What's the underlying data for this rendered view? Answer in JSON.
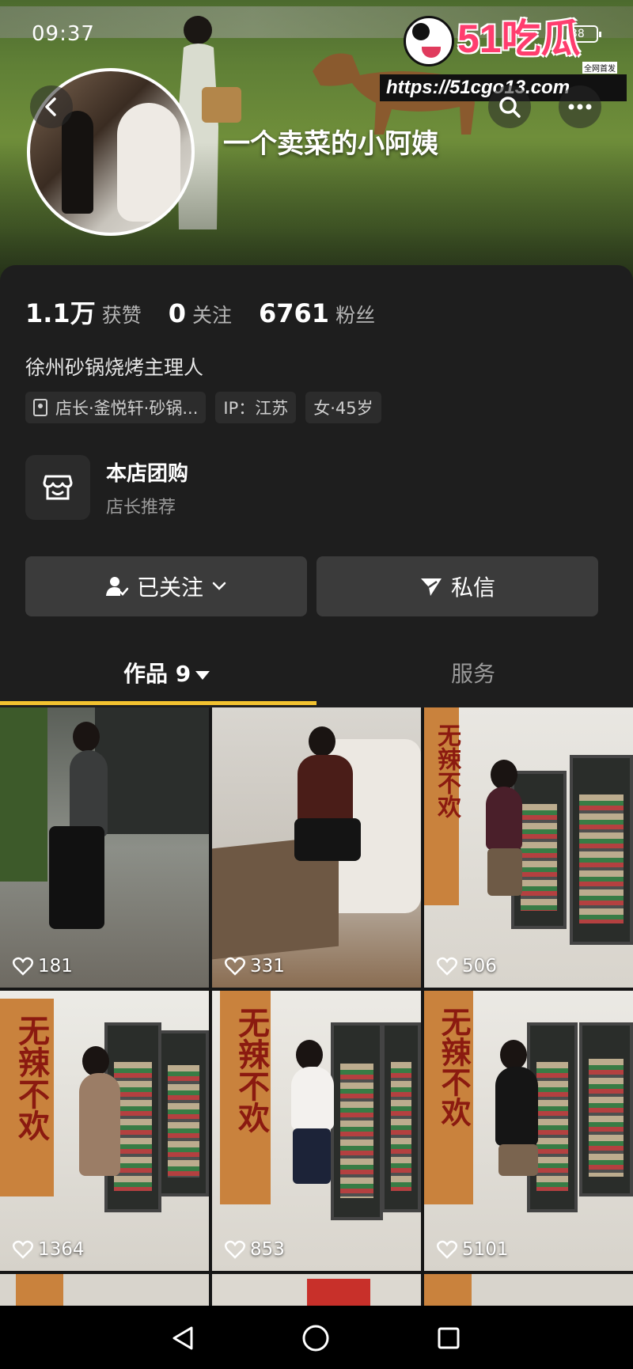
{
  "status_bar": {
    "time": "09:37",
    "battery": "38"
  },
  "watermark": {
    "brand": "51吃瓜",
    "tag": "全网首发",
    "url": "https://51cgo13.com"
  },
  "profile": {
    "nickname": "一个卖菜的小阿姨",
    "stats": [
      {
        "value": "1.1万",
        "label": "获赞"
      },
      {
        "value": "0",
        "label": "关注"
      },
      {
        "value": "6761",
        "label": "粉丝"
      }
    ],
    "bio": "徐州砂锅烧烤主理人",
    "tags": [
      "店长·釜悦轩·砂锅...",
      "IP：江苏",
      "女·45岁"
    ]
  },
  "shop": {
    "title": "本店团购",
    "subtitle": "店长推荐"
  },
  "actions": {
    "follow_label": "已关注",
    "message_label": "私信"
  },
  "tabs": {
    "works_label": "作品 9",
    "service_label": "服务"
  },
  "videos": [
    {
      "likes": "181"
    },
    {
      "likes": "331"
    },
    {
      "likes": "506"
    },
    {
      "likes": "1364"
    },
    {
      "likes": "853"
    },
    {
      "likes": "5101"
    }
  ],
  "banner_text": "无辣不欢",
  "colors": {
    "accent": "#f2c230",
    "background": "#1e1e1e",
    "button": "#3b3b3b"
  }
}
